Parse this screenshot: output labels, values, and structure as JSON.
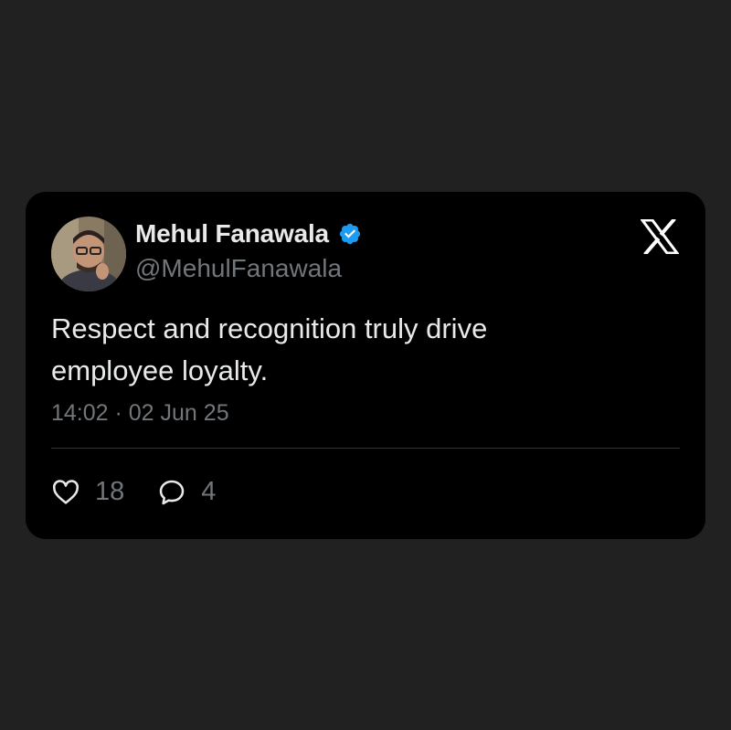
{
  "tweet": {
    "author": {
      "display_name": "Mehul Fanawala",
      "handle": "@MehulFanawala",
      "verified": true
    },
    "text_lines": [
      "Respect and recognition truly drive",
      "employee loyalty."
    ],
    "timestamp": "14:02 · 02 Jun 25",
    "likes": "18",
    "replies": "4"
  },
  "brand": {
    "logo_icon": "x-logo-icon"
  },
  "colors": {
    "page_background": "#212121",
    "card_background": "#000000",
    "primary_text": "#e7e9ea",
    "secondary_text": "#71767b",
    "verified_badge": "#1d9bf0"
  }
}
